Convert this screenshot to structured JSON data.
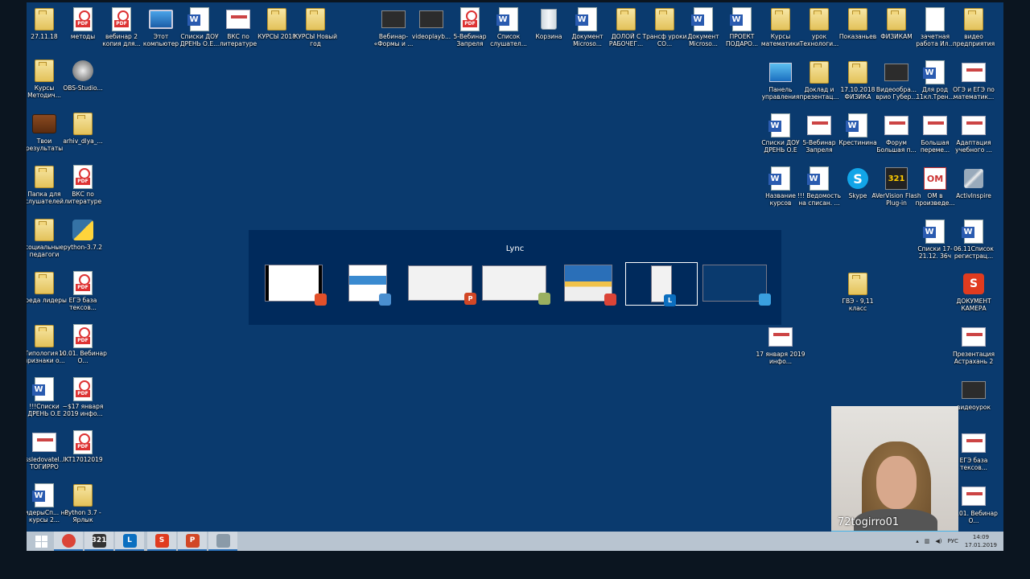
{
  "desktop": {
    "icons_top_row": [
      {
        "label": "27.11.18",
        "type": "folder"
      },
      {
        "label": "методы",
        "type": "pdf"
      },
      {
        "label": "вебинар 2 копия для...",
        "type": "pdf"
      },
      {
        "label": "Этот компьютер",
        "type": "pc"
      },
      {
        "label": "Списки ДОУ ДРЕНЬ О.Е...",
        "type": "word"
      },
      {
        "label": "ВКС по литературе",
        "type": "thumb"
      },
      {
        "label": "КУРСЫ 2018",
        "type": "folder"
      },
      {
        "label": "КУРСЫ Новый год",
        "type": "folder"
      },
      {
        "label": "Вебинар- «Формы и ...",
        "type": "video"
      },
      {
        "label": "videoplayb...",
        "type": "video"
      },
      {
        "label": "5-Вебинар Запреля",
        "type": "pdf"
      },
      {
        "label": "Список слушател...",
        "type": "word"
      },
      {
        "label": "Корзина",
        "type": "trash"
      },
      {
        "label": "Документ Microso...",
        "type": "word"
      },
      {
        "label": "ДОЛОЙ С РАБОЧЕГ...",
        "type": "folder"
      },
      {
        "label": "Трансф уроки СО...",
        "type": "folder"
      },
      {
        "label": "Документ Microso...",
        "type": "word"
      },
      {
        "label": "ПРОЕКТ ПОДАРО...",
        "type": "word"
      },
      {
        "label": "Курсы математики",
        "type": "folder"
      },
      {
        "label": "урок Технологи...",
        "type": "folder"
      },
      {
        "label": "Показаньев",
        "type": "folder"
      },
      {
        "label": "ФИЗИКАМ",
        "type": "folder"
      },
      {
        "label": "зачетная работа Ил...",
        "type": "doc"
      },
      {
        "label": "видео предприятия",
        "type": "folder"
      }
    ],
    "icons_left_col": [
      {
        "label": "Курсы Методич...",
        "type": "folder"
      },
      {
        "label": "OBS-Studio...",
        "type": "obs"
      },
      {
        "label": "Твои результаты",
        "type": "chest"
      },
      {
        "label": "arhiv_dlya_...",
        "type": "folder"
      },
      {
        "label": "Папка для слушателей",
        "type": "folder"
      },
      {
        "label": "ВКС по литературе",
        "type": "pdf"
      },
      {
        "label": "социальные педагоги",
        "type": "folder"
      },
      {
        "label": "python-3.7.2",
        "type": "py"
      },
      {
        "label": "среда лидеры",
        "type": "folder"
      },
      {
        "label": "ЕГЭ база тексов...",
        "type": "pdf"
      },
      {
        "label": "Типология и признаки о...",
        "type": "folder"
      },
      {
        "label": "10.01. Вебинар О...",
        "type": "pdf"
      },
      {
        "label": "!!!Списки ДРЕНЬ О.Е",
        "type": "word"
      },
      {
        "label": "~$17 января 2019 инфо...",
        "type": "pdf"
      },
      {
        "label": "issledovatel... ТОГИРРО",
        "type": "thumb"
      },
      {
        "label": "IKT17012019",
        "type": "pdf"
      },
      {
        "label": "ЛидерыСп... на курсы 2...",
        "type": "word"
      },
      {
        "label": "Python 3.7 - Ярлык",
        "type": "folder"
      }
    ],
    "icons_right_area": [
      {
        "label": "Панель управления",
        "type": "panel"
      },
      {
        "label": "Доклад и презентац...",
        "type": "folder"
      },
      {
        "label": "17.10.2018 ФИЗИКА",
        "type": "folder"
      },
      {
        "label": "Видеообра... врио Губер...",
        "type": "video"
      },
      {
        "label": "Для род 11кл.Трен...",
        "type": "word"
      },
      {
        "label": "ОГЭ и ЕГЭ по математик...",
        "type": "thumb"
      },
      {
        "label": "Списки ДОУ ДРЕНЬ О.Е",
        "type": "word"
      },
      {
        "label": "5-Вебинар Запреля",
        "type": "thumb"
      },
      {
        "label": "Крестинина",
        "type": "word"
      },
      {
        "label": "Форум Большая п...",
        "type": "thumb"
      },
      {
        "label": "Большая переме...",
        "type": "thumb"
      },
      {
        "label": "Адаптация учебного ...",
        "type": "thumb"
      },
      {
        "label": "Название курсов",
        "type": "word"
      },
      {
        "label": "!!! Ведомость на списан. ...",
        "type": "word"
      },
      {
        "label": "Skype",
        "type": "skype"
      },
      {
        "label": "AVerVision Flash Plug-in",
        "type": "av"
      },
      {
        "label": "ОМ в произведе...",
        "type": "om"
      },
      {
        "label": "ActivInspire",
        "type": "pen"
      },
      {
        "label": "Списки 17-21.12. 36ч",
        "type": "word"
      },
      {
        "label": "06.11Список регистрац...",
        "type": "word"
      },
      {
        "label": "ГВЭ - 9,11 класс",
        "type": "folder"
      },
      {
        "label": "ДОКУМЕНТ КАМЕРА",
        "type": "app"
      },
      {
        "label": "17 января 2019 инфо...",
        "type": "thumb"
      },
      {
        "label": "Презентация Астрахань 2",
        "type": "thumb"
      },
      {
        "label": "видеоурок",
        "type": "video"
      },
      {
        "label": "ЕГЭ база тексов...",
        "type": "thumb"
      },
      {
        "label": "10.01. Вебинар О...",
        "type": "thumb"
      }
    ]
  },
  "switcher": {
    "title": "Lync",
    "windows": [
      {
        "name": "pdf-window",
        "badge": "pdf",
        "badge_color": "#e2502a"
      },
      {
        "name": "explorer-window",
        "badge": "explorer",
        "badge_color": "#4a8fd0"
      },
      {
        "name": "powerpoint-window",
        "badge": "P",
        "badge_color": "#d24726"
      },
      {
        "name": "paint-window",
        "badge": "paint",
        "badge_color": "#9ab060"
      },
      {
        "name": "chrome-window",
        "badge": "chrome",
        "badge_color": "#db4437"
      },
      {
        "name": "lync-window",
        "badge": "L",
        "badge_color": "#0b6fc0",
        "active": true
      },
      {
        "name": "desktop-window",
        "badge": "desktop",
        "badge_color": "#3aa0e0"
      }
    ]
  },
  "webcam": {
    "name": "72togirro01"
  },
  "taskbar": {
    "items": [
      {
        "name": "start",
        "label": ""
      },
      {
        "name": "chrome",
        "label": "",
        "color": "#db4437"
      },
      {
        "name": "avervision",
        "label": "321",
        "color": "#333"
      },
      {
        "name": "lync",
        "label": "L",
        "color": "#0b6fc0"
      },
      {
        "name": "document-camera",
        "label": "S",
        "color": "#e03b1f"
      },
      {
        "name": "powerpoint",
        "label": "P",
        "color": "#d24726"
      },
      {
        "name": "activinspire",
        "label": "",
        "color": "#8a9aa8"
      }
    ],
    "tray": {
      "language": "РУС",
      "time": "14:09",
      "date": "17.01.2019"
    }
  }
}
